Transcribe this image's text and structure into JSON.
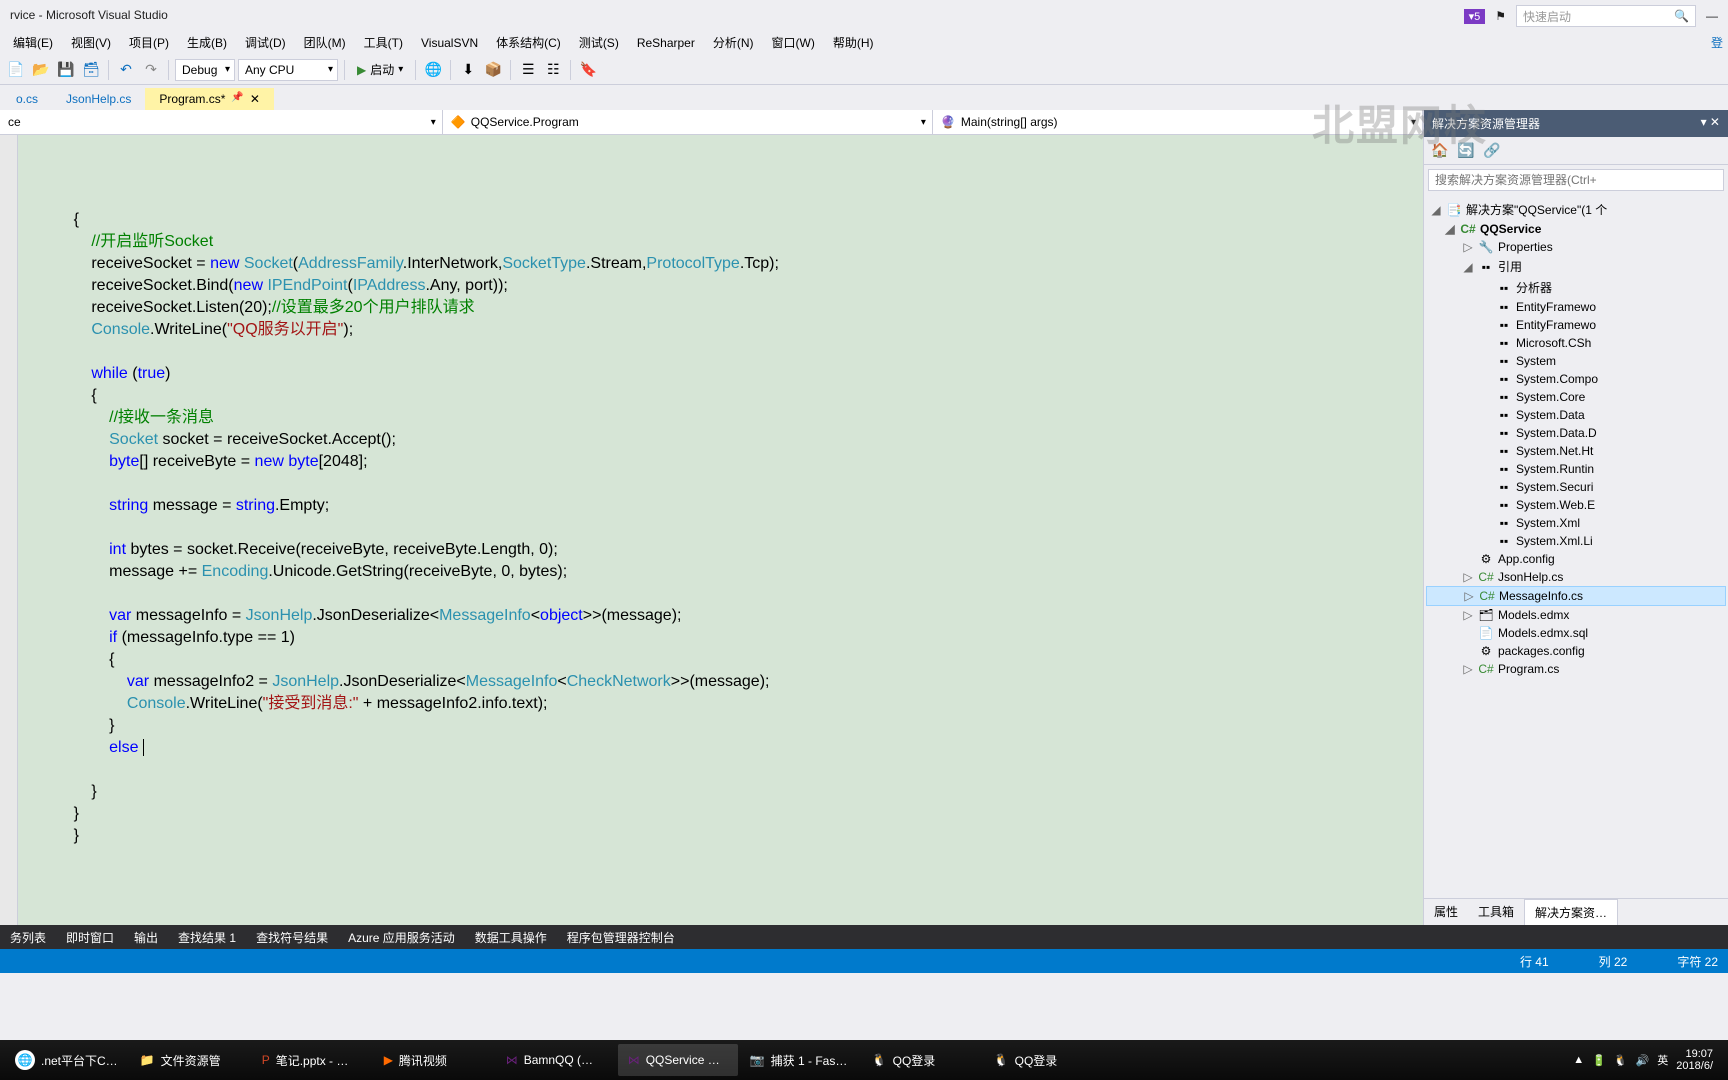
{
  "title": "rvice - Microsoft Visual Studio",
  "quicklaunch_placeholder": "快速启动",
  "notif_count": "5",
  "menu": {
    "edit": "编辑(E)",
    "view": "视图(V)",
    "project": "项目(P)",
    "build": "生成(B)",
    "debug": "调试(D)",
    "team": "团队(M)",
    "tools": "工具(T)",
    "svn": "VisualSVN",
    "arch": "体系结构(C)",
    "test": "测试(S)",
    "resharper": "ReSharper",
    "analyze": "分析(N)",
    "window": "窗口(W)",
    "help": "帮助(H)"
  },
  "toolbar": {
    "config": "Debug",
    "platform": "Any CPU",
    "start": "启动"
  },
  "tabs": {
    "t1": "o.cs",
    "t2": "JsonHelp.cs",
    "t3": "Program.cs*"
  },
  "nav": {
    "left": "ce",
    "mid": "QQService.Program",
    "right": "Main(string[] args)"
  },
  "code": {
    "l1": "        {",
    "l2_cmt": "//开启监听Socket",
    "l3a": "receiveSocket = ",
    "l3_new": "new ",
    "l3_type": "Socket",
    "l3b": "(",
    "l3_type2": "AddressFamily",
    "l3c": ".InterNetwork,",
    "l3_type3": "SocketType",
    "l3d": ".Stream,",
    "l3_type4": "ProtocolType",
    "l3e": ".Tcp);",
    "l4a": "receiveSocket.Bind(",
    "l4_new": "new ",
    "l4_type": "IPEndPoint",
    "l4b": "(",
    "l4_type2": "IPAddress",
    "l4c": ".Any, port));",
    "l5a": "receiveSocket.Listen(20);",
    "l5_cmt": "//设置最多20个用户排队请求",
    "l6_type": "Console",
    "l6a": ".WriteLine(",
    "l6_str": "\"QQ服务以开启\"",
    "l6b": ");",
    "l7_kw": "while ",
    "l7a": "(",
    "l7_true": "true",
    "l7b": ")",
    "l8": "{",
    "l9_cmt": "//接收一条消息",
    "l10_type": "Socket",
    "l10a": " socket = receiveSocket.Accept();",
    "l11_kw": "byte",
    "l11a": "[] receiveByte = ",
    "l11_new": "new ",
    "l11_kw2": "byte",
    "l11b": "[2048];",
    "l12_kw": "string",
    "l12a": " message = ",
    "l12_kw2": "string",
    "l12b": ".Empty;",
    "l13_kw": "int",
    "l13a": " bytes = socket.Receive(receiveByte, receiveByte.Length, 0);",
    "l14a": "message += ",
    "l14_type": "Encoding",
    "l14b": ".Unicode.GetString(receiveByte, 0, bytes);",
    "l15_kw": "var",
    "l15a": " messageInfo = ",
    "l15_type": "JsonHelp",
    "l15b": ".JsonDeserialize<",
    "l15_type2": "MessageInfo",
    "l15c": "<",
    "l15_kw2": "object",
    "l15d": ">>(message);",
    "l16_kw": "if",
    "l16a": " (messageInfo.type == 1)",
    "l17": "{",
    "l18_kw": "var",
    "l18a": " messageInfo2 = ",
    "l18_type": "JsonHelp",
    "l18b": ".JsonDeserialize<",
    "l18_type2": "MessageInfo",
    "l18c": "<",
    "l18_type3": "CheckNetwork",
    "l18d": ">>(message);",
    "l19_type": "Console",
    "l19a": ".WriteLine(",
    "l19_str": "\"接受到消息:\"",
    "l19b": " + messageInfo2.info.text);",
    "l20": "}",
    "l21_kw": "else",
    "l22": "}",
    "l23": "}",
    "l24": "}"
  },
  "solution": {
    "title": "解决方案资源管理器",
    "search": "搜索解决方案资源管理器(Ctrl+",
    "root": "解决方案\"QQService\"(1 个",
    "proj": "QQService",
    "props": "Properties",
    "refs": "引用",
    "r": [
      "分析器",
      "EntityFramewo",
      "EntityFramewo",
      "Microsoft.CSh",
      "System",
      "System.Compo",
      "System.Core",
      "System.Data",
      "System.Data.D",
      "System.Net.Ht",
      "System.Runtin",
      "System.Securi",
      "System.Web.E",
      "System.Xml",
      "System.Xml.Li"
    ],
    "files": [
      "App.config",
      "JsonHelp.cs",
      "MessageInfo.cs",
      "Models.edmx",
      "Models.edmx.sql",
      "packages.config",
      "Program.cs"
    ]
  },
  "sidetabs": {
    "props": "属性",
    "toolbox": "工具箱",
    "solution": "解决方案资…"
  },
  "status": {
    "line": "行 41",
    "col": "列 22",
    "char": "字符 22"
  },
  "bottom": [
    "务列表",
    "即时窗口",
    "输出",
    "查找结果 1",
    "查找符号结果",
    "Azure 应用服务活动",
    "数据工具操作",
    "程序包管理器控制台"
  ],
  "tasks": {
    "t1": ".net平台下C…",
    "t2": "文件资源管",
    "t3": "笔记.pptx - …",
    "t4": "腾讯视频",
    "t5": "BamnQQ (…",
    "t6": "QQService …",
    "t7": "捕获 1 - Fas…",
    "t8": "QQ登录",
    "t9": "QQ登录"
  },
  "tray": {
    "ime": "英",
    "time": "19:07",
    "date": "2018/6/"
  },
  "watermark": "北盟网校"
}
